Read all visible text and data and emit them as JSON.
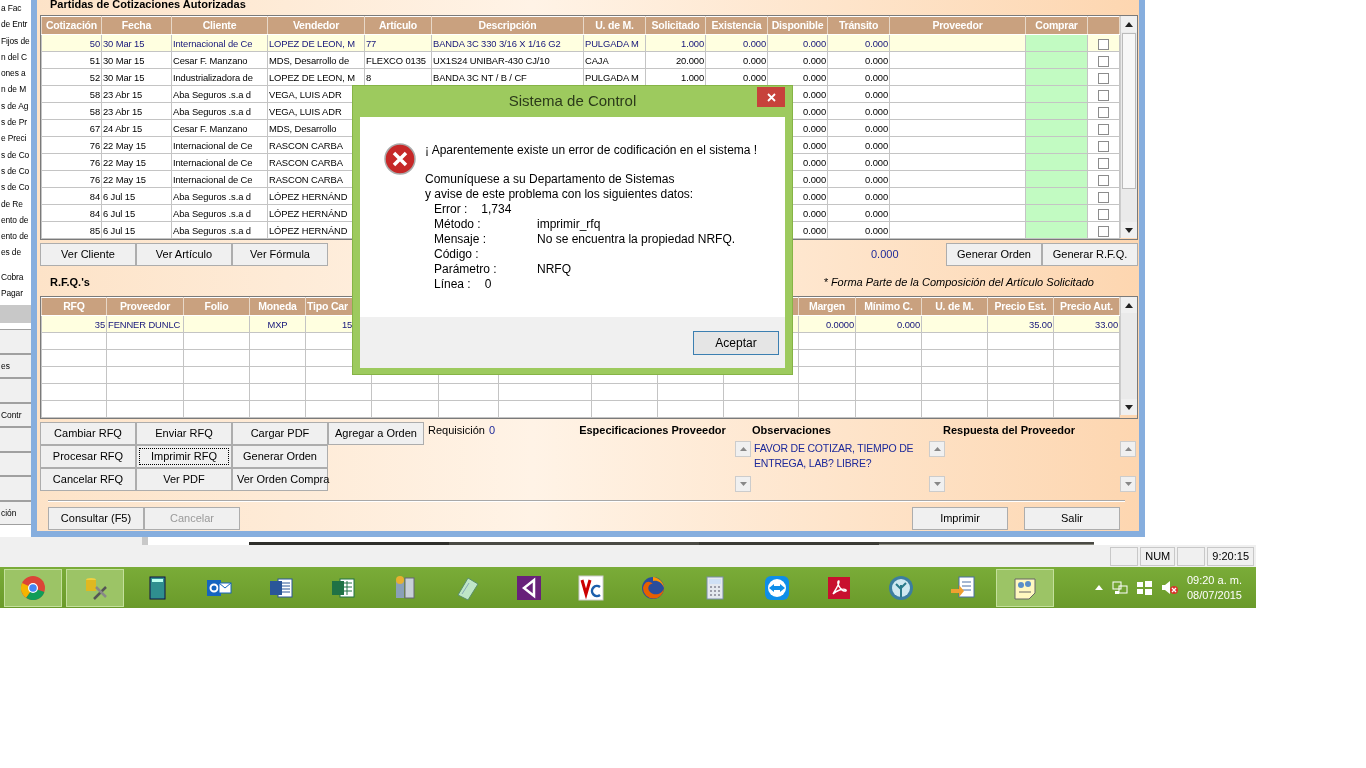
{
  "left_panel": {
    "menu_items": [
      "a Fac",
      "de Entr",
      "Fijos de",
      "n del C",
      "ones a",
      "n de M",
      "s de Ag",
      "s de Pr",
      "e Preci",
      "s de Co",
      "s de Co",
      "s de Co",
      "de Re",
      "ento de",
      "ento de",
      "es de"
    ],
    "lower_items": [
      "Cobra",
      "Pagar"
    ],
    "buttons": [
      {
        "kind": "blank"
      },
      {
        "kind": "labeled",
        "label": "es"
      },
      {
        "kind": "blank"
      },
      {
        "kind": "labeled",
        "label": "Contr"
      },
      {
        "kind": "blank"
      },
      {
        "kind": "blank"
      },
      {
        "kind": "blank"
      },
      {
        "kind": "labeled",
        "label": "ción"
      }
    ]
  },
  "window": {
    "group_title": "Partidas de Cotizaciones Autorizadas",
    "items_table": {
      "columns": [
        "Cotización",
        "Fecha",
        "Cliente",
        "Vendedor",
        "Artículo",
        "Descripción",
        "U. de M.",
        "Solicitado",
        "Existencia",
        "Disponible",
        "Tránsito",
        "Proveedor",
        "Comprar"
      ],
      "rows": [
        {
          "selected": true,
          "checked": false,
          "cotizacion": "50",
          "fecha": "30 Mar 15",
          "cliente": "Internacional de Ce",
          "vendedor": "LOPEZ DE LEON, M",
          "articulo": "77",
          "descripcion": "BANDA 3C 330 3/16 X 1/16 G2",
          "um": "PULGADA M",
          "solicitado": "1.000",
          "existencia": "0.000",
          "disponible": "0.000",
          "transito": "0.000"
        },
        {
          "selected": false,
          "checked": false,
          "cotizacion": "51",
          "fecha": "30 Mar 15",
          "cliente": "Cesar F. Manzano",
          "vendedor": "MDS, Desarrollo de",
          "articulo": "FLEXCO 0135",
          "descripcion": "UX1S24 UNIBAR-430 CJ/10",
          "um": "CAJA",
          "solicitado": "20.000",
          "existencia": "0.000",
          "disponible": "0.000",
          "transito": "0.000"
        },
        {
          "selected": false,
          "checked": false,
          "cotizacion": "52",
          "fecha": "30 Mar 15",
          "cliente": "Industrializadora de",
          "vendedor": "LOPEZ DE LEON, M",
          "articulo": "8",
          "descripcion": "BANDA 3C NT / B / CF",
          "um": "PULGADA M",
          "solicitado": "1.000",
          "existencia": "0.000",
          "disponible": "0.000",
          "transito": "0.000"
        },
        {
          "selected": false,
          "checked": false,
          "cotizacion": "58",
          "fecha": "23 Abr 15",
          "cliente": "Aba Seguros .s.a d",
          "vendedor": "VEGA, LUIS ADR",
          "disponible": "0.000",
          "transito": "0.000"
        },
        {
          "selected": false,
          "checked": false,
          "cotizacion": "58",
          "fecha": "23 Abr 15",
          "cliente": "Aba Seguros .s.a d",
          "vendedor": "VEGA, LUIS ADR",
          "disponible": "0.000",
          "transito": "0.000"
        },
        {
          "selected": false,
          "checked": false,
          "cotizacion": "67",
          "fecha": "24 Abr 15",
          "cliente": "Cesar F. Manzano",
          "vendedor": "MDS, Desarrollo",
          "disponible": "0.000",
          "transito": "0.000"
        },
        {
          "selected": false,
          "checked": false,
          "cotizacion": "76",
          "fecha": "22 May 15",
          "cliente": "Internacional de Ce",
          "vendedor": "RASCON CARBA",
          "disponible": "0.000",
          "transito": "0.000"
        },
        {
          "selected": false,
          "checked": false,
          "cotizacion": "76",
          "fecha": "22 May 15",
          "cliente": "Internacional de Ce",
          "vendedor": "RASCON CARBA",
          "disponible": "0.000",
          "transito": "0.000"
        },
        {
          "selected": false,
          "checked": false,
          "cotizacion": "76",
          "fecha": "22 May 15",
          "cliente": "Internacional de Ce",
          "vendedor": "RASCON CARBA",
          "disponible": "0.000",
          "transito": "0.000"
        },
        {
          "selected": false,
          "checked": false,
          "cotizacion": "84",
          "fecha": "6 Jul 15",
          "cliente": "Aba Seguros .s.a d",
          "vendedor": "LÓPEZ HERNÁND",
          "disponible": "0.000",
          "transito": "0.000"
        },
        {
          "selected": false,
          "checked": false,
          "cotizacion": "84",
          "fecha": "6 Jul 15",
          "cliente": "Aba Seguros .s.a d",
          "vendedor": "LÓPEZ HERNÁND",
          "disponible": "0.000",
          "transito": "0.000"
        },
        {
          "selected": false,
          "checked": false,
          "cotizacion": "85",
          "fecha": "6 Jul 15",
          "cliente": "Aba Seguros .s.a d",
          "vendedor": "LÓPEZ HERNÁND",
          "disponible": "0.000",
          "transito": "0.000"
        }
      ]
    },
    "view_buttons": [
      "Ver Cliente",
      "Ver Artículo",
      "Ver Fórmula"
    ],
    "total": "0.000",
    "action_buttons": [
      "Generar Orden",
      "Generar R.F.Q."
    ],
    "rfq_title": "R.F.Q.'s",
    "note": "* Forma Parte de la Composición del Artículo Solicitado",
    "rfq_table": {
      "columns_left": [
        "RFQ",
        "Proveedor",
        "Folio",
        "Moneda",
        "Tipo Car"
      ],
      "columns_right": [
        "Margen",
        "Mínimo C.",
        "U. de M.",
        "Precio Est.",
        "Precio Aut."
      ],
      "rows": [
        {
          "selected": true,
          "rfq": "35",
          "proveedor": "FENNER DUNLC",
          "moneda": "MXP",
          "tipo": "15",
          "margen": "0.0000",
          "minimo": "0.000",
          "precio_est": "35.00",
          "precio_aut": "33.00"
        }
      ]
    },
    "rfq_buttons": [
      [
        {
          "label": "Cambiar RFQ",
          "focused": false
        },
        {
          "label": "Enviar RFQ",
          "focused": false
        },
        {
          "label": "Cargar PDF",
          "focused": false
        }
      ],
      [
        {
          "label": "Procesar RFQ",
          "focused": false
        },
        {
          "label": "Imprimir RFQ",
          "focused": true
        },
        {
          "label": "Generar Orden",
          "focused": false
        }
      ],
      [
        {
          "label": "Cancelar RFQ",
          "focused": false
        },
        {
          "label": "Ver PDF",
          "focused": false
        },
        {
          "label": "Ver Orden Compra",
          "focused": false
        }
      ]
    ],
    "add_button": "Agregar a Orden",
    "requisicion": {
      "label": "Requisición",
      "value": "0"
    },
    "especificaciones_title": "Especificaciones Proveedor",
    "observaciones": {
      "title": "Observaciones",
      "text": "FAVOR DE COTIZAR, TIEMPO DE ENTREGA, LAB? LIBRE?"
    },
    "respuesta_title": "Respuesta del Proveedor",
    "footer_left": [
      {
        "label": "Consultar (F5)",
        "disabled": false
      },
      {
        "label": "Cancelar",
        "disabled": true
      }
    ],
    "footer_right": [
      {
        "label": "Imprimir",
        "disabled": false
      },
      {
        "label": "Salir",
        "disabled": false
      }
    ]
  },
  "dialog": {
    "title": "Sistema de Control",
    "headline": "¡ Aparentemente existe un error de codificación en el sistema !",
    "intro": [
      "Comuníquese a su Departamento de Sistemas",
      "y avise de este problema con los siguientes datos:"
    ],
    "fields": [
      {
        "kind": "inline",
        "label": "Error :",
        "value": "1,734"
      },
      {
        "kind": "column",
        "label": "Método :",
        "value": "imprimir_rfq"
      },
      {
        "kind": "column",
        "label": "Mensaje :",
        "value": "No se encuentra la propiedad NRFQ."
      },
      {
        "kind": "column",
        "label": "Código :"
      },
      {
        "kind": "column",
        "label": "Parámetro :",
        "value": "NRFQ"
      },
      {
        "kind": "inline",
        "label": "Línea :",
        "value": "0"
      }
    ],
    "button": "Aceptar"
  },
  "status_bar": {
    "panels": [
      {
        "kind": "blank"
      },
      {
        "kind": "text",
        "text": "NUM"
      },
      {
        "kind": "blank"
      },
      {
        "kind": "text",
        "text": "9:20:15"
      }
    ]
  },
  "taskbar": {
    "items": [
      {
        "kind": "browser",
        "highlighted": true
      },
      {
        "kind": "tools",
        "highlighted": true
      },
      {
        "kind": "notebook",
        "highlighted": false
      },
      {
        "kind": "mail",
        "highlighted": false
      },
      {
        "kind": "word",
        "highlighted": false
      },
      {
        "kind": "spreadsheet",
        "highlighted": false
      },
      {
        "kind": "server",
        "highlighted": false
      },
      {
        "kind": "notepad",
        "highlighted": false
      },
      {
        "kind": "ide",
        "highlighted": false
      },
      {
        "kind": "remote",
        "highlighted": false
      },
      {
        "kind": "firefox",
        "highlighted": false
      },
      {
        "kind": "calculator",
        "highlighted": false
      },
      {
        "kind": "teamviewer",
        "highlighted": false
      },
      {
        "kind": "pdf",
        "highlighted": false
      },
      {
        "kind": "tree",
        "highlighted": false
      },
      {
        "kind": "transfer",
        "highlighted": false
      },
      {
        "kind": "notes",
        "highlighted": true
      }
    ],
    "time": "09:20 a. m.",
    "date": "08/07/2015"
  }
}
